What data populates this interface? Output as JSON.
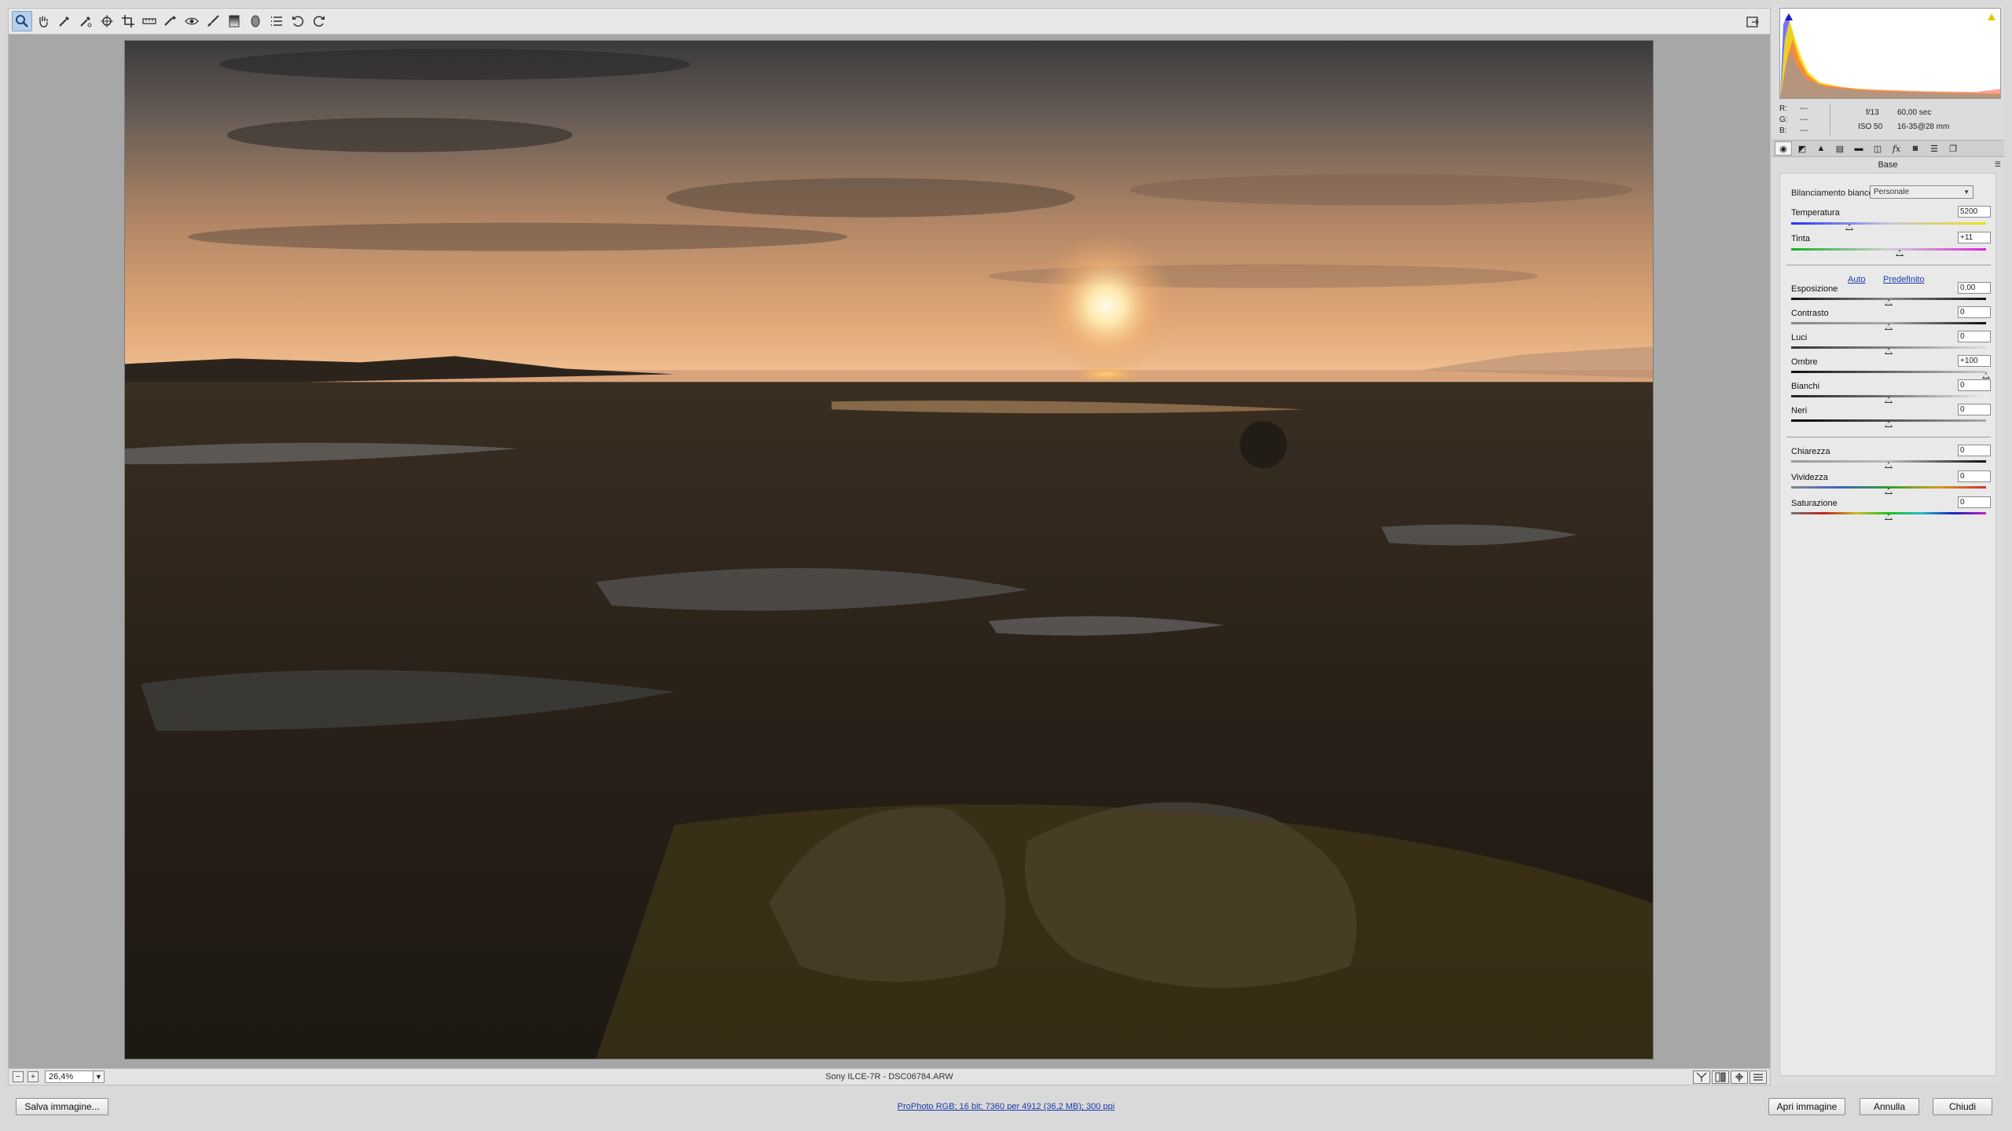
{
  "toolbar": {
    "tools": [
      "zoom-icon",
      "hand-icon",
      "white-balance-icon",
      "color-sampler-icon",
      "targeted-adjustment-icon",
      "crop-icon",
      "straighten-icon",
      "spot-removal-icon",
      "red-eye-icon",
      "adjustment-brush-icon",
      "graduated-filter-icon",
      "radial-filter-icon",
      "preferences-list-icon",
      "rotate-left-icon",
      "rotate-right-icon"
    ]
  },
  "statusbar": {
    "zoom_value": "26,4%",
    "filename": "Sony ILCE-7R  -  DSC06784.ARW"
  },
  "bottombar": {
    "save_label": "Salva immagine...",
    "workflow_options": "ProPhoto RGB; 16 bit; 7360 per 4912 (36,2 MB); 300 ppi",
    "open_label": "Apri immagine",
    "cancel_label": "Annulla",
    "close_label": "Chiudi"
  },
  "info": {
    "r_label": "R:",
    "r_value": "---",
    "g_label": "G:",
    "g_value": "---",
    "b_label": "B:",
    "b_value": "---",
    "aperture": "f/13",
    "shutter": "60,00 sec",
    "iso": "ISO 50",
    "lens": "16-35@28 mm"
  },
  "panel": {
    "title": "Base",
    "wb_label": "Bilanciamento bianco:",
    "wb_value": "Personale",
    "auto_label": "Auto",
    "default_label": "Predefinito",
    "sliders": {
      "temperatura": {
        "label": "Temperatura",
        "value": "5200",
        "pos": 0.3
      },
      "tinta": {
        "label": "Tinta",
        "value": "+11",
        "pos": 0.555
      },
      "esposizione": {
        "label": "Esposizione",
        "value": "0,00",
        "pos": 0.5
      },
      "contrasto": {
        "label": "Contrasto",
        "value": "0",
        "pos": 0.5
      },
      "luci": {
        "label": "Luci",
        "value": "0",
        "pos": 0.5
      },
      "ombre": {
        "label": "Ombre",
        "value": "+100",
        "pos": 1.0
      },
      "bianchi": {
        "label": "Bianchi",
        "value": "0",
        "pos": 0.5
      },
      "neri": {
        "label": "Neri",
        "value": "0",
        "pos": 0.5
      },
      "chiarezza": {
        "label": "Chiarezza",
        "value": "0",
        "pos": 0.5
      },
      "vividezza": {
        "label": "Vividezza",
        "value": "0",
        "pos": 0.5
      },
      "saturazione": {
        "label": "Saturazione",
        "value": "0",
        "pos": 0.5
      }
    }
  },
  "colors": {
    "accent": "#b8cfe8",
    "link": "#1c3aa9"
  }
}
